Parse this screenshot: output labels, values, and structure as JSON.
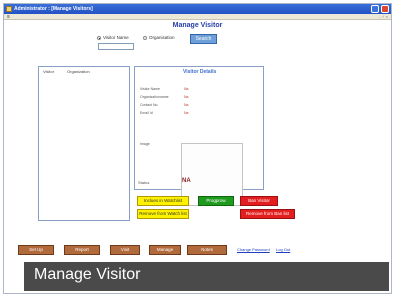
{
  "window": {
    "title": "Administrator : [Manage Visitors]",
    "menu_glyph": "≡",
    "menu_right": "- ♂ ×"
  },
  "header": {
    "title": "Manage Visitor"
  },
  "search": {
    "option_visitor_name": "Visitor Name",
    "option_organisation": "Organisation",
    "selected": "Visitor Name",
    "input_value": "",
    "button_label": "Search"
  },
  "list_panel": {
    "columns": [
      "Visitor",
      "Organization"
    ]
  },
  "details": {
    "title": "Visitor Details",
    "fields": [
      {
        "label": "Visitor Name",
        "value": "Na"
      },
      {
        "label": "Organizationname",
        "value": "Na"
      },
      {
        "label": "Contact No.",
        "value": "Na"
      },
      {
        "label": "Email Id",
        "value": "Na"
      }
    ],
    "image_label": "Image",
    "status_label": "Status",
    "status_value": "NA"
  },
  "actions": {
    "include_watch": "Inclues in Watchlist",
    "progrow": "Progprow",
    "ban": "Ban Visitor",
    "remove_watch": "Remove from Watch list",
    "remove_ban": "Remove from Ban list"
  },
  "nav": {
    "buttons": [
      "Set Up",
      "Report",
      "Visit",
      "Manage",
      "Notes"
    ],
    "change_password": "Change Password",
    "log_out": "Log Out"
  },
  "caption": "Manage Visitor",
  "colors": {
    "title_blue": "#2640a8",
    "nav_brown": "#b06a3c",
    "yellow": "#fff200",
    "green": "#1f9a1f",
    "red": "#e31e1e",
    "caption_bg": "#4a4a4a"
  }
}
